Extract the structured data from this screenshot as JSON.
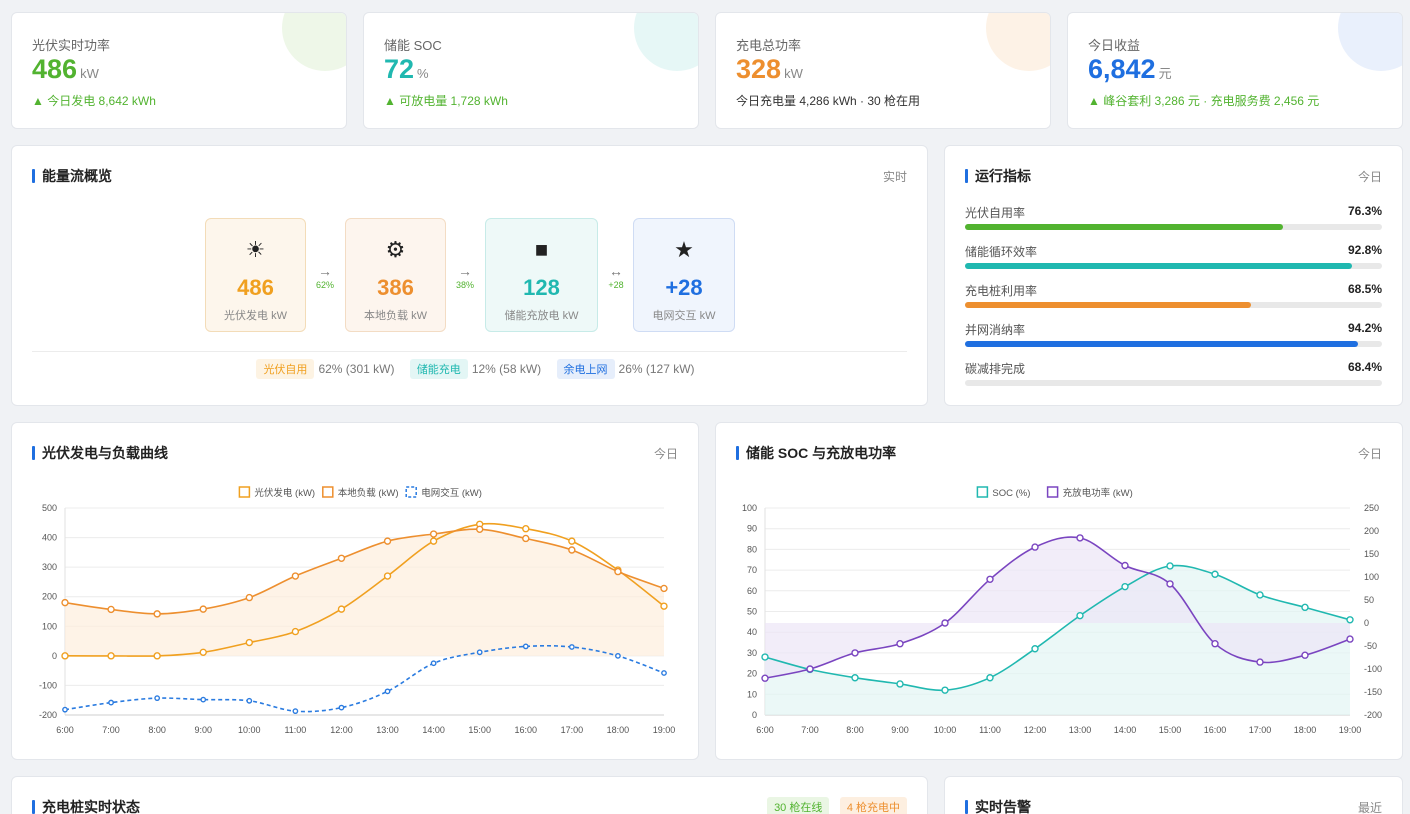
{
  "kpis": [
    {
      "label": "光伏实时功率",
      "value": "486",
      "unit": "kW",
      "sub": "▲ 今日发电 8,642 kWh",
      "color": "#52b330",
      "sub_color": "#52b330",
      "deco": "#eef7e8"
    },
    {
      "label": "储能 SOC",
      "value": "72",
      "unit": "%",
      "sub": "▲ 可放电量 1,728 kWh",
      "color": "#20b8b0",
      "sub_color": "#52b330",
      "deco": "#e6f7f6"
    },
    {
      "label": "充电总功率",
      "value": "328",
      "unit": "kW",
      "sub": "今日充电量 4,286 kWh · 30 枪在用",
      "color": "#ed8f2f",
      "sub_color": "#333333",
      "deco": "#fdf2e6"
    },
    {
      "label": "今日收益",
      "value": "6,842",
      "unit": "元",
      "sub": "▲ 峰谷套利 3,286 元 · 充电服务费 2,456 元",
      "color": "#1f6fe0",
      "sub_color": "#52b330",
      "deco": "#e9f0fc"
    }
  ],
  "energy_flow": {
    "title": "能量流概览",
    "right": "实时",
    "nodes": [
      {
        "icon": "sun-icon",
        "glyph": "☀",
        "value": "486",
        "label": "光伏发电 kW",
        "color": "#f0a020"
      },
      {
        "icon": "gear-icon",
        "glyph": "⚙",
        "value": "386",
        "label": "本地负载 kW",
        "color": "#ed8f2f"
      },
      {
        "icon": "battery-icon",
        "glyph": "■",
        "value": "128",
        "label": "储能充放电 kW",
        "color": "#20b8b0"
      },
      {
        "icon": "star-icon",
        "glyph": "★",
        "value": "+28",
        "label": "电网交互 kW",
        "color": "#1f6fe0"
      }
    ],
    "arrows": [
      {
        "glyph": "→",
        "pct": "62%"
      },
      {
        "glyph": "→",
        "pct": "38%"
      },
      {
        "glyph": "↔",
        "pct": "+28"
      }
    ],
    "legend": [
      {
        "tag": "光伏自用",
        "text": "62% (301 kW)",
        "color": "#f0a020",
        "bg": "#fdf3e3"
      },
      {
        "tag": "储能充电",
        "text": "12% (58 kW)",
        "color": "#20b8b0",
        "bg": "#e3f6f5"
      },
      {
        "tag": "余电上网",
        "text": "26% (127 kW)",
        "color": "#1f6fe0",
        "bg": "#e6eefb"
      }
    ]
  },
  "metrics": {
    "title": "运行指标",
    "right": "今日",
    "items": [
      {
        "label": "光伏自用率",
        "value": "76.3%",
        "pct": 76.3,
        "color": "#52b330"
      },
      {
        "label": "储能循环效率",
        "value": "92.8%",
        "pct": 92.8,
        "color": "#20b8b0"
      },
      {
        "label": "充电桩利用率",
        "value": "68.5%",
        "pct": 68.5,
        "color": "#ed8f2f"
      },
      {
        "label": "并网消纳率",
        "value": "94.2%",
        "pct": 94.2,
        "color": "#1f6fe0"
      },
      {
        "label": "碳减排完成",
        "value": "68.4%",
        "pct": 0,
        "color": "#8a8a8a"
      }
    ]
  },
  "pv_chart": {
    "title": "光伏发电与负载曲线",
    "right": "今日"
  },
  "soc_chart": {
    "title": "储能 SOC 与充放电功率",
    "right": "今日"
  },
  "chargers": {
    "title": "充电桩实时状态",
    "badge_online": "30 枪在线",
    "badge_charging": "4 枪充电中"
  },
  "alarms": {
    "title": "实时告警",
    "right": "最近"
  },
  "chart_data": [
    {
      "type": "line",
      "x": [
        "6:00",
        "7:00",
        "8:00",
        "9:00",
        "10:00",
        "11:00",
        "12:00",
        "13:00",
        "14:00",
        "15:00",
        "16:00",
        "17:00",
        "18:00",
        "19:00"
      ],
      "ylim": [
        -200,
        500
      ],
      "yticks": [
        500,
        400,
        300,
        200,
        100,
        0,
        -100,
        -200
      ],
      "grid": true,
      "legend_position": "top",
      "series": [
        {
          "name": "光伏发电 (kW)",
          "color": "#f0a020",
          "style": "solid",
          "values": [
            0,
            0,
            0,
            12,
            45,
            82,
            158,
            270,
            388,
            445,
            430,
            388,
            290,
            168
          ]
        },
        {
          "name": "本地负载 (kW)",
          "color": "#ed8f2f",
          "style": "solid",
          "fill": "#fdeedd",
          "values": [
            180,
            157,
            142,
            158,
            197,
            270,
            330,
            388,
            412,
            428,
            397,
            358,
            285,
            228
          ]
        },
        {
          "name": "电网交互 (kW)",
          "color": "#2a7be0",
          "style": "dashed",
          "values": [
            -182,
            -158,
            -143,
            -148,
            -152,
            -187,
            -175,
            -120,
            -25,
            12,
            32,
            30,
            0,
            -58
          ]
        }
      ]
    },
    {
      "type": "line",
      "x": [
        "6:00",
        "7:00",
        "8:00",
        "9:00",
        "10:00",
        "11:00",
        "12:00",
        "13:00",
        "14:00",
        "15:00",
        "16:00",
        "17:00",
        "18:00",
        "19:00"
      ],
      "ylim": [
        0,
        100
      ],
      "yticks": [
        100,
        90,
        80,
        70,
        60,
        50,
        40,
        30,
        20,
        10,
        0
      ],
      "y2lim": [
        -200,
        250
      ],
      "y2ticks": [
        250,
        200,
        150,
        100,
        50,
        0,
        -50,
        -100,
        -150,
        -200
      ],
      "grid": true,
      "legend_position": "top",
      "series": [
        {
          "name": "SOC (%)",
          "axis": "left",
          "color": "#20b8b0",
          "fill": "#e2f5f4",
          "values": [
            28,
            22,
            18,
            15,
            12,
            18,
            32,
            48,
            62,
            72,
            68,
            58,
            52,
            46
          ]
        },
        {
          "name": "充放电功率 (kW)",
          "axis": "right",
          "color": "#7a45c0",
          "fill": "#ede6f7",
          "values": [
            -120,
            -100,
            -65,
            -45,
            0,
            95,
            165,
            185,
            125,
            85,
            -45,
            -85,
            -70,
            -35
          ]
        }
      ]
    }
  ]
}
